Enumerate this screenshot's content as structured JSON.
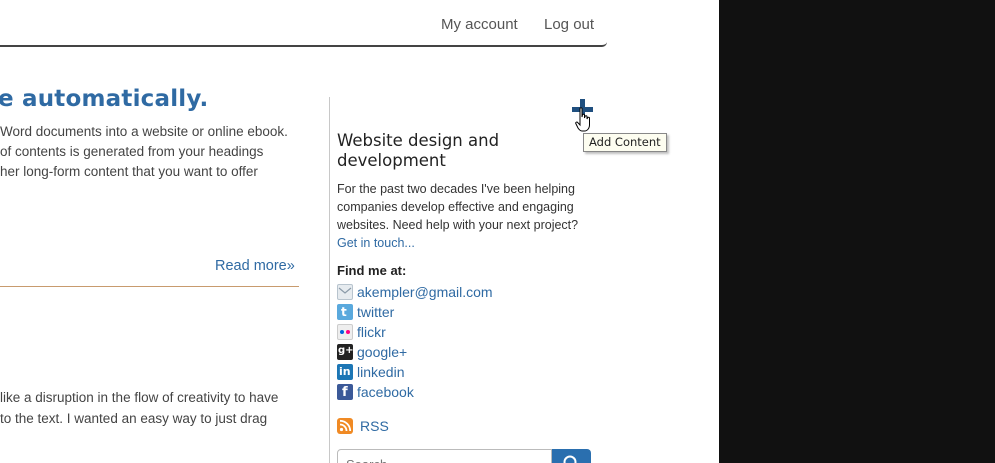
{
  "nav": {
    "my_account": "My account",
    "log_out": "Log out"
  },
  "article": {
    "headline": "e automatically.",
    "lines": [
      "Word documents into a website or online ebook.",
      " of contents is generated from your headings",
      "her long-form content that you want to offer"
    ],
    "read_more": "Read more»",
    "lines2": [
      " like a disruption in the flow of creativity to have",
      " to the text. I wanted an easy way to just drag"
    ]
  },
  "add_content": {
    "tooltip": "Add Content",
    "icon": "plus-icon"
  },
  "sidebar": {
    "title": "Website design and development",
    "bio": [
      "For the past two decades I've been helping",
      "companies develop effective and engaging",
      "websites. Need help with your next project?"
    ],
    "get_in_touch": "Get in touch...",
    "find_me": "Find me at:",
    "social": [
      {
        "label": "akempler@gmail.com",
        "icon": "email-icon"
      },
      {
        "label": "twitter",
        "icon": "twitter-icon"
      },
      {
        "label": "flickr",
        "icon": "flickr-icon"
      },
      {
        "label": "google+",
        "icon": "google-plus-icon"
      },
      {
        "label": "linkedin",
        "icon": "linkedin-icon"
      },
      {
        "label": "facebook",
        "icon": "facebook-icon"
      }
    ],
    "rss": {
      "label": "RSS",
      "icon": "rss-icon"
    },
    "search_placeholder": "Search",
    "search_icon": "search-icon"
  },
  "colors": {
    "link": "#2f6aa3",
    "accent_button": "#2a6faf",
    "background_right": "#111111"
  }
}
